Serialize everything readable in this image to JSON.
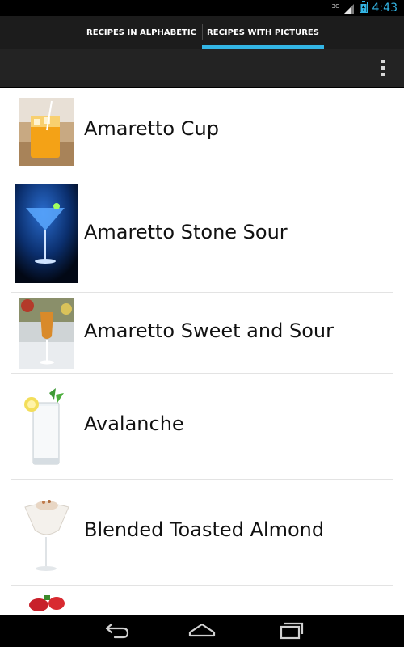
{
  "status_bar": {
    "network": "3G",
    "time": "4:43",
    "accent": "#33b5e5"
  },
  "tabs": [
    {
      "label": "RECIPES IN ALPHABETIC",
      "selected": false
    },
    {
      "label": "RECIPES WITH PICTURES",
      "selected": true
    }
  ],
  "action_bar": {
    "overflow_icon": "overflow-menu-icon"
  },
  "recipes": [
    {
      "name": "Amaretto Cup"
    },
    {
      "name": "Amaretto Stone Sour"
    },
    {
      "name": "Amaretto Sweet and Sour"
    },
    {
      "name": "Avalanche"
    },
    {
      "name": "Blended Toasted Almond"
    }
  ],
  "nav_bar": {
    "buttons": [
      "back-icon",
      "home-icon",
      "recents-icon"
    ]
  }
}
